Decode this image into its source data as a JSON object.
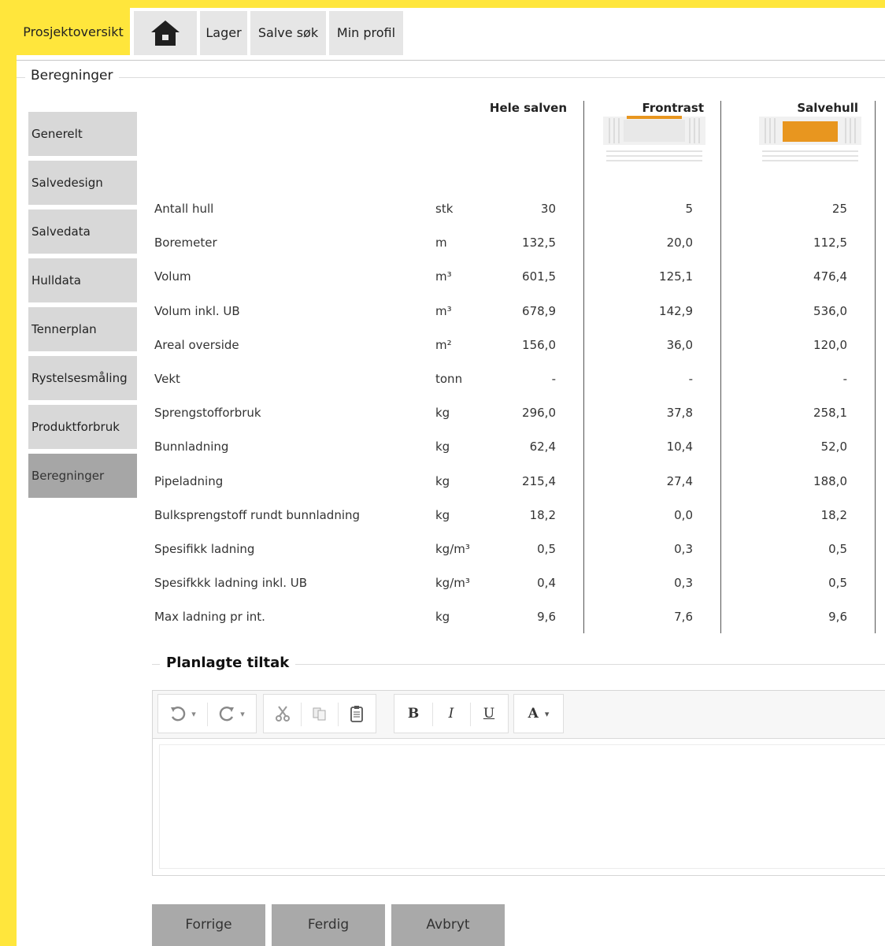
{
  "nav": {
    "tabs": [
      {
        "label": "Prosjektoversikt"
      },
      {
        "label": "Lager"
      },
      {
        "label": "Salve søk"
      },
      {
        "label": "Min profil"
      }
    ],
    "home_icon": "home-icon"
  },
  "section_title": "Beregninger",
  "sidebar": {
    "items": [
      {
        "label": "Generelt"
      },
      {
        "label": "Salvedesign"
      },
      {
        "label": "Salvedata"
      },
      {
        "label": "Hulldata"
      },
      {
        "label": "Tennerplan"
      },
      {
        "label": "Rystelsesmåling"
      },
      {
        "label": "Produktforbruk"
      },
      {
        "label": "Beregninger"
      }
    ],
    "active": "Beregninger"
  },
  "table": {
    "columns": [
      "Hele salven",
      "Frontrast",
      "Salvehull"
    ],
    "rows": [
      {
        "label": "Antall hull",
        "unit": "stk",
        "values": [
          "30",
          "5",
          "25"
        ]
      },
      {
        "label": "Boremeter",
        "unit": "m",
        "values": [
          "132,5",
          "20,0",
          "112,5"
        ]
      },
      {
        "label": "Volum",
        "unit": "m³",
        "values": [
          "601,5",
          "125,1",
          "476,4"
        ]
      },
      {
        "label": "Volum inkl. UB",
        "unit": "m³",
        "values": [
          "678,9",
          "142,9",
          "536,0"
        ]
      },
      {
        "label": "Areal overside",
        "unit": "m²",
        "values": [
          "156,0",
          "36,0",
          "120,0"
        ]
      },
      {
        "label": "Vekt",
        "unit": "tonn",
        "values": [
          "-",
          "-",
          "-"
        ]
      },
      {
        "label": "Sprengstofforbruk",
        "unit": "kg",
        "values": [
          "296,0",
          "37,8",
          "258,1"
        ]
      },
      {
        "label": "Bunnladning",
        "unit": "kg",
        "values": [
          "62,4",
          "10,4",
          "52,0"
        ]
      },
      {
        "label": "Pipeladning",
        "unit": "kg",
        "values": [
          "215,4",
          "27,4",
          "188,0"
        ]
      },
      {
        "label": "Bulksprengstoff rundt bunnladning",
        "unit": "kg",
        "values": [
          "18,2",
          "0,0",
          "18,2"
        ]
      },
      {
        "label": "Spesifikk ladning",
        "unit": "kg/m³",
        "values": [
          "0,5",
          "0,3",
          "0,5"
        ]
      },
      {
        "label": "Spesifkkk ladning inkl. UB",
        "unit": "kg/m³",
        "values": [
          "0,4",
          "0,3",
          "0,5"
        ]
      },
      {
        "label": "Max ladning pr int.",
        "unit": "kg",
        "values": [
          "9,6",
          "7,6",
          "9,6"
        ]
      }
    ]
  },
  "tiltak": {
    "title": "Planlagte tiltak",
    "content": "",
    "toolbar": {
      "bold": "B",
      "italic": "I",
      "underline": "U",
      "font_color": "A",
      "dropdown_glyph": "▾",
      "undo_icon": "undo-icon",
      "redo_icon": "redo-icon",
      "cut_icon": "cut-icon",
      "copy_icon": "copy-icon",
      "paste_icon": "paste-icon"
    }
  },
  "buttons": {
    "previous": "Forrige",
    "finish": "Ferdig",
    "cancel": "Avbryt"
  },
  "colors": {
    "frame": "#ffe63c",
    "active_tab": "#ffe63c",
    "thumb_accent": "#e8961f"
  }
}
